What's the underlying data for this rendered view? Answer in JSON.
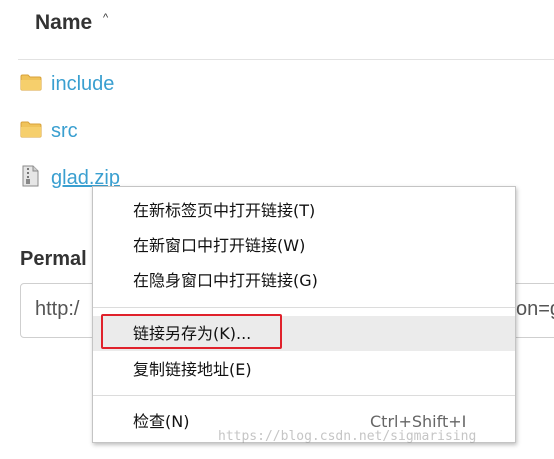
{
  "file_list": {
    "header": {
      "name_label": "Name",
      "sort_icon": "sort-ascending-caret",
      "sort_glyph": "^"
    },
    "items": [
      {
        "name": "include",
        "icon": "folder-icon"
      },
      {
        "name": "src",
        "icon": "folder-icon"
      },
      {
        "name": "glad.zip",
        "icon": "file-icon"
      }
    ],
    "link_color": "#3a9fd0"
  },
  "permalink": {
    "label": "Permal",
    "value_prefix": "http:/",
    "value_suffix": "on=g"
  },
  "context_menu": {
    "items": [
      {
        "label": "在新标签页中打开链接(T)",
        "shortcut": ""
      },
      {
        "label": "在新窗口中打开链接(W)",
        "shortcut": ""
      },
      {
        "label": "在隐身窗口中打开链接(G)",
        "shortcut": ""
      },
      {
        "label": "链接另存为(K)...",
        "shortcut": ""
      },
      {
        "label": "复制链接地址(E)",
        "shortcut": ""
      },
      {
        "label": "检查(N)",
        "shortcut": "Ctrl+Shift+I"
      }
    ],
    "highlighted_index": 3,
    "annotation_color": "#e0212b"
  },
  "watermark": "https://blog.csdn.net/sigmarising"
}
